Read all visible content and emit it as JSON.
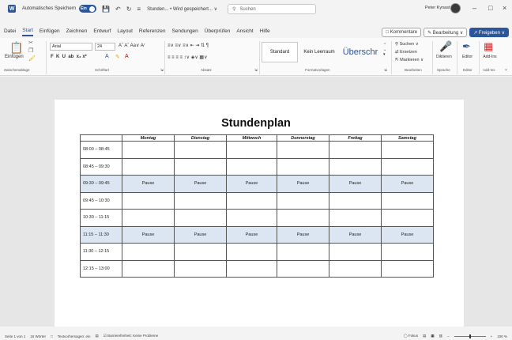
{
  "titlebar": {
    "autosave_label": "Automatisches Speichern",
    "toggle_label": "Ein",
    "doc_title": "Stunden... • Wird gespeichert... ∨",
    "search_placeholder": "Suchen",
    "user_name": "Peter Kynast",
    "minimize": "–",
    "maximize": "□",
    "close": "×"
  },
  "menu": {
    "tabs": [
      "Datei",
      "Start",
      "Einfügen",
      "Zeichnen",
      "Entwurf",
      "Layout",
      "Referenzen",
      "Sendungen",
      "Überprüfen",
      "Ansicht",
      "Hilfe"
    ],
    "active_tab": "Start",
    "comments_button": "Kommentare",
    "editing_button": "Bearbeitung ∨",
    "share_button": "Freigeben ∨"
  },
  "ribbon": {
    "paste_label": "Einfügen",
    "font_name": "Arial",
    "font_size": "24",
    "style_standard": "Standard",
    "style_no_spacing": "Kein Leerraum",
    "style_heading": "Überschr",
    "search_label": "Suchen ∨",
    "replace_label": "Ersetzen",
    "select_label": "Markieren ∨",
    "dictate_label": "Diktieren",
    "editor_label": "Editor",
    "addins_label": "Add-Ins",
    "groups": {
      "clipboard": "Zwischenablage",
      "font": "Schriftart",
      "paragraph": "Absatz",
      "styles": "Formatvorlagen",
      "editing": "Bearbeiten",
      "voice": "Sprache",
      "editor": "Editor",
      "addins": "Add-Ins"
    }
  },
  "document": {
    "heading": "Stundenplan",
    "columns": [
      "",
      "Montag",
      "Dienstag",
      "Mittwoch",
      "Donnerstag",
      "Freitag",
      "Samstag"
    ],
    "rows": [
      {
        "time": "08:00 – 08:45",
        "cells": [
          "",
          "",
          "",
          "",
          "",
          ""
        ],
        "pause": false
      },
      {
        "time": "08:45 – 09:30",
        "cells": [
          "",
          "",
          "",
          "",
          "",
          ""
        ],
        "pause": false
      },
      {
        "time": "09:30 – 09:45",
        "cells": [
          "Pause",
          "Pause",
          "Pause",
          "Pause",
          "Pause",
          "Pause"
        ],
        "pause": true
      },
      {
        "time": "09:45 – 10:30",
        "cells": [
          "",
          "",
          "",
          "",
          "",
          ""
        ],
        "pause": false
      },
      {
        "time": "10:30 – 11:15",
        "cells": [
          "",
          "",
          "",
          "",
          "",
          ""
        ],
        "pause": false
      },
      {
        "time": "11:15 – 11:30",
        "cells": [
          "Pause",
          "Pause",
          "Pause",
          "Pause",
          "Pause",
          "Pause"
        ],
        "pause": true
      },
      {
        "time": "11:30 – 12:15",
        "cells": [
          "",
          "",
          "",
          "",
          "",
          ""
        ],
        "pause": false
      },
      {
        "time": "12:15 – 13:00",
        "cells": [
          "",
          "",
          "",
          "",
          "",
          ""
        ],
        "pause": false
      }
    ]
  },
  "status": {
    "page": "Seite 1 von 1",
    "words": "15 Wörter",
    "prediction": "Textvorhersagen: ein",
    "accessibility": "Barrierefreiheit: Keine Probleme",
    "focus": "Fokus",
    "zoom": "100 %"
  }
}
